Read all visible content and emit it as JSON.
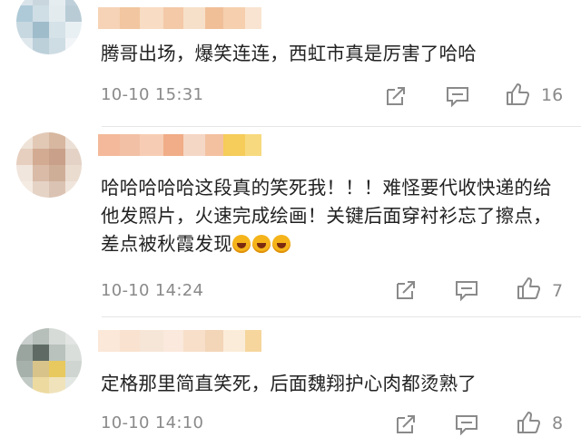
{
  "comments": [
    {
      "text": "腾哥出场，爆笑连连，西虹市真是厉害了哈哈",
      "time": "10-10 15:31",
      "likes": "16",
      "avatar_colors": [
        "#d9e3ea",
        "#c9d6dd",
        "#e6edf1",
        "#bfd0da",
        "#aecad8",
        "#cfdde5",
        "#e3ebef",
        "#b9ccd6",
        "#c7d8e0",
        "#9fbccb",
        "#d5e2e8",
        "#e9f0f3",
        "#dfe8ed",
        "#bcd0da",
        "#cedce3",
        "#f2f5f7"
      ],
      "name_colors": [
        "#f6d3b6",
        "#f2c6a0",
        "#f8dcc3",
        "#f3c9a7",
        "#f7e0c9",
        "#f0bf98",
        "#f5cfae",
        "#f9e4d1"
      ]
    },
    {
      "text": "哈哈哈哈哈这段真的笑死我！！！难怪要代收快递的给他发照片，火速完成绘画！关键后面穿衬衫忘了擦点，差点被秋霞发现",
      "emoji_count": 3,
      "time": "10-10 14:24",
      "likes": "7",
      "avatar_colors": [
        "#efe3d8",
        "#e2c9b6",
        "#d7b7a0",
        "#ece0d6",
        "#e6cfbf",
        "#d2ab92",
        "#c9a08a",
        "#e3d2c5",
        "#f1e6dd",
        "#d9bba7",
        "#cfae98",
        "#ebdcd0",
        "#f4ebe3",
        "#e5d3c6",
        "#dbc3b3",
        "#f0e5dc"
      ],
      "name_colors": [
        "#f3b99a",
        "#f2c0a4",
        "#f6cdb4",
        "#f0ad87",
        "#f5d7c5",
        "#f3c1a0",
        "#f6cc5a",
        "#f7d97f"
      ]
    },
    {
      "text": "定格那里简直笑死，后面魏翔护心肉都烫熟了",
      "time": "10-10 14:10",
      "likes": "8",
      "avatar_colors": [
        "#c9cfcc",
        "#b7bfba",
        "#d6dbd8",
        "#e2e5e3",
        "#9aa59f",
        "#5f6a64",
        "#b9c2bd",
        "#d9dedb",
        "#a7b1ab",
        "#d8c48a",
        "#e8c95f",
        "#cfd5d1",
        "#c2cac5",
        "#eddaa0",
        "#f0e3bb",
        "#e3e7e4"
      ],
      "name_colors": [
        "#fbe8d9",
        "#f9e2cf",
        "#f6e6d8",
        "#fae9dc",
        "#f7dfca",
        "#f3d5b8",
        "#fbecd9",
        "#f6d69d"
      ]
    }
  ],
  "icon_color": "#8a8a8a"
}
